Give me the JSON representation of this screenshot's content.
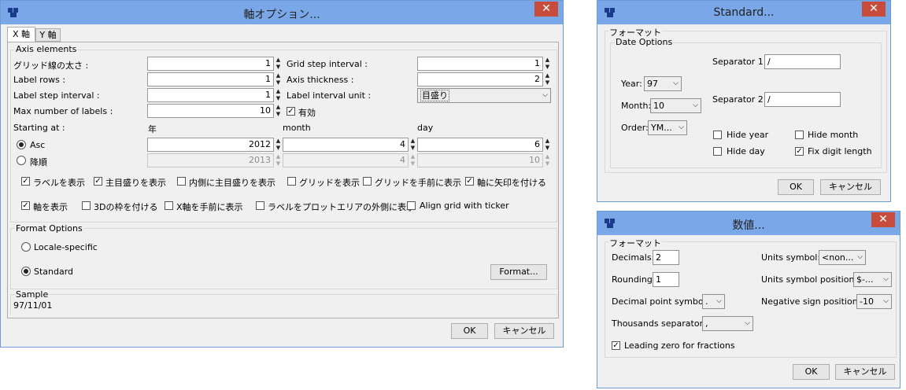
{
  "colors": {
    "titlebar": "#79a7e8",
    "close": "#c74c3c",
    "face": "#f0f0f0"
  },
  "icons": {
    "app": "app-icon",
    "close": "close-icon",
    "check": "checkmark",
    "spin": "spin-arrows",
    "dropdown": "chevron-down-icon"
  },
  "axis_dialog": {
    "title": "軸オプション...",
    "tabs": [
      "X 軸",
      "Y 軸"
    ],
    "axis_elements": {
      "legend": "Axis elements",
      "gridline_width_label": "グリッド線の太さ :",
      "gridline_width": "1",
      "label_rows_label": "Label rows :",
      "label_rows": "1",
      "label_step_label": "Label step interval :",
      "label_step": "1",
      "max_labels_label": "Max number of labels :",
      "max_labels": "10",
      "grid_step_label": "Grid step interval :",
      "grid_step": "1",
      "axis_thickness_label": "Axis thickness :",
      "axis_thickness": "2",
      "label_unit_label": "Label interval unit :",
      "label_unit": "目盛り",
      "enabled_label": "有効"
    },
    "starting_at": {
      "label": "Starting at :",
      "col_year": "年",
      "col_month": "month",
      "col_day": "day",
      "asc_label": "Asc",
      "desc_label": "降順",
      "asc_year": "2012",
      "asc_month": "4",
      "asc_day": "6",
      "desc_year": "2013",
      "desc_month": "4",
      "desc_day": "10"
    },
    "checks_row1": [
      {
        "label": "ラベルを表示",
        "checked": true
      },
      {
        "label": "主目盛りを表示",
        "checked": true
      },
      {
        "label": "内側に主目盛りを表示",
        "checked": false
      },
      {
        "label": "グリッドを表示",
        "checked": false
      },
      {
        "label": "グリッドを手前に表示",
        "checked": false
      },
      {
        "label": "軸に矢印を付ける",
        "checked": true
      }
    ],
    "checks_row2": [
      {
        "label": "軸を表示",
        "checked": true
      },
      {
        "label": "3Dの枠を付ける",
        "checked": false
      },
      {
        "label": "X軸を手前に表示",
        "checked": false
      },
      {
        "label": "ラベルをプロットエリアの外側に表示",
        "checked": false
      },
      {
        "label": "Align grid with ticker",
        "checked": false
      }
    ],
    "format_options": {
      "legend": "Format Options",
      "locale": "Locale-specific",
      "standard": "Standard",
      "format_button": "Format..."
    },
    "sample": {
      "legend": "Sample",
      "value": "97/11/01"
    },
    "ok": "OK",
    "cancel": "キャンセル"
  },
  "standard_dialog": {
    "title": "Standard...",
    "group": "フォーマット",
    "date_options": "Date Options",
    "separator1_label": "Separator 1:",
    "separator1": "/",
    "separator2_label": "Separator 2:",
    "separator2": "/",
    "year_label": "Year:",
    "year": "97",
    "month_label": "Month:",
    "month": "10",
    "order_label": "Order:",
    "order": "YM...",
    "hide_year": "Hide year",
    "hide_month": "Hide month",
    "hide_day": "Hide day",
    "fix_digit": "Fix digit length",
    "ok": "OK",
    "cancel": "キャンセル"
  },
  "number_dialog": {
    "title": "数値...",
    "group": "フォーマット",
    "decimals_label": "Decimals:",
    "decimals": "2",
    "rounding_label": "Rounding:",
    "rounding": "1",
    "decimal_symbol_label": "Decimal point symbol:",
    "decimal_symbol": ".",
    "thousands_label": "Thousands separator:",
    "thousands": ",",
    "units_symbol_label": "Units symbol:",
    "units_symbol": "<non...",
    "units_pos_label": "Units symbol position:",
    "units_pos": "$-...",
    "neg_pos_label": "Negative sign position:",
    "neg_pos": "-10",
    "leading_zero": "Leading zero for fractions",
    "ok": "OK",
    "cancel": "キャンセル"
  }
}
